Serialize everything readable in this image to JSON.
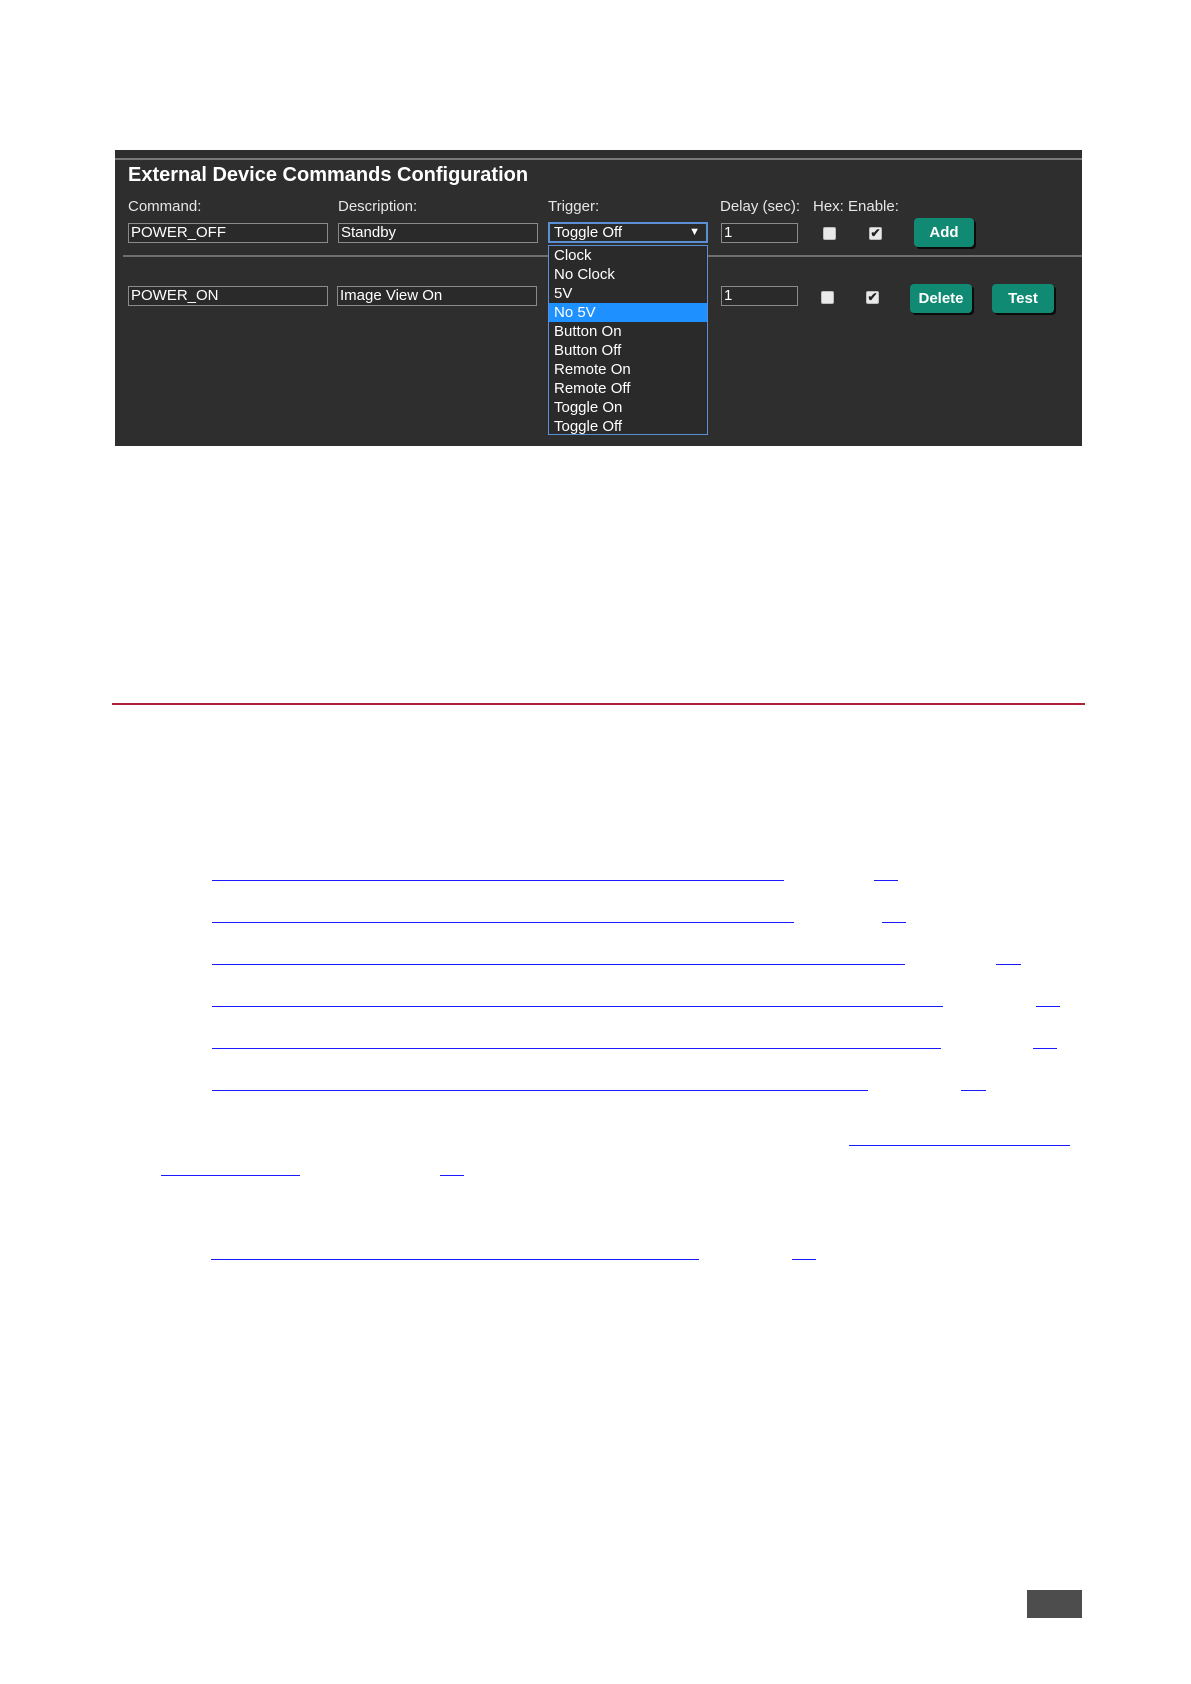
{
  "panel": {
    "title": "External Device Commands Configuration",
    "labels": {
      "command": "Command:",
      "description": "Description:",
      "trigger": "Trigger:",
      "delay": "Delay (sec):",
      "hex": "Hex:",
      "enable": "Enable:"
    },
    "new_row": {
      "command": "POWER_OFF",
      "description": "Standby",
      "trigger": "Toggle Off",
      "delay": "1",
      "hex_checked": false,
      "enable_checked": true,
      "add_label": "Add"
    },
    "rows": [
      {
        "command": "POWER_ON",
        "description": "Image View On",
        "delay": "1",
        "hex_checked": false,
        "enable_checked": true,
        "delete_label": "Delete",
        "test_label": "Test"
      }
    ],
    "trigger_options": [
      "Clock",
      "No Clock",
      "5V",
      "No 5V",
      "Button On",
      "Button Off",
      "Remote On",
      "Remote Off",
      "Toggle On",
      "Toggle Off"
    ],
    "highlighted_option": "No 5V",
    "dropdown_arrow": "▼",
    "check_glyph": "✔"
  },
  "colors": {
    "panel_bg": "#2e2e2e",
    "button_teal": "#108a73",
    "option_highlight": "#1e90ff",
    "section_rule": "#b0203b",
    "link_blue": "#1a1aff"
  }
}
